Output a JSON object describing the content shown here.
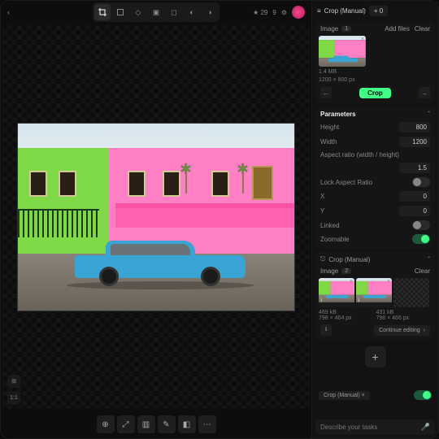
{
  "topbar": {
    "back": "‹",
    "rating": "★ 29",
    "plusnum": "9"
  },
  "tools": [
    "crop",
    "expand",
    "ratio",
    "rot-l",
    "rot-r",
    "flip-h",
    "flip-v"
  ],
  "panel": {
    "title": "Crop (Manual)",
    "plusmode": "+ 0",
    "image_label": "Image",
    "image_count": "1",
    "add_files": "Add files",
    "clear": "Clear",
    "thumb_meta1": "1.4 MB",
    "thumb_meta2": "1200 × 800 px",
    "crop_btn": "Crop",
    "params_title": "Parameters",
    "height_label": "Height",
    "height_val": "800",
    "width_label": "Width",
    "width_val": "1200",
    "aspect_label": "Aspect ratio (width / height)",
    "aspect_val": "1.5",
    "lock_label": "Lock Aspect Ratio",
    "x_label": "X",
    "x_val": "0",
    "y_label": "Y",
    "y_val": "0",
    "linked_label": "Linked",
    "zoom_label": "Zoomable"
  },
  "result": {
    "title": "Crop (Manual)",
    "image_label": "Image",
    "image_count": "2",
    "clear": "Clear",
    "meta_a1": "469 kB",
    "meta_a2": "798 × 464 px",
    "meta_b1": "431 kB",
    "meta_b2": "798 × 466 px",
    "continue": "Continue editing",
    "arrow": "›"
  },
  "prompt": {
    "chip": "Crop (Manual) ×",
    "placeholder": "Describe your tasks"
  },
  "leftbar": {
    "a": "⊞",
    "b": "1:1"
  },
  "bottomtools": [
    "⊕",
    "⤢",
    "▥",
    "✎",
    "◧",
    "⋯"
  ]
}
